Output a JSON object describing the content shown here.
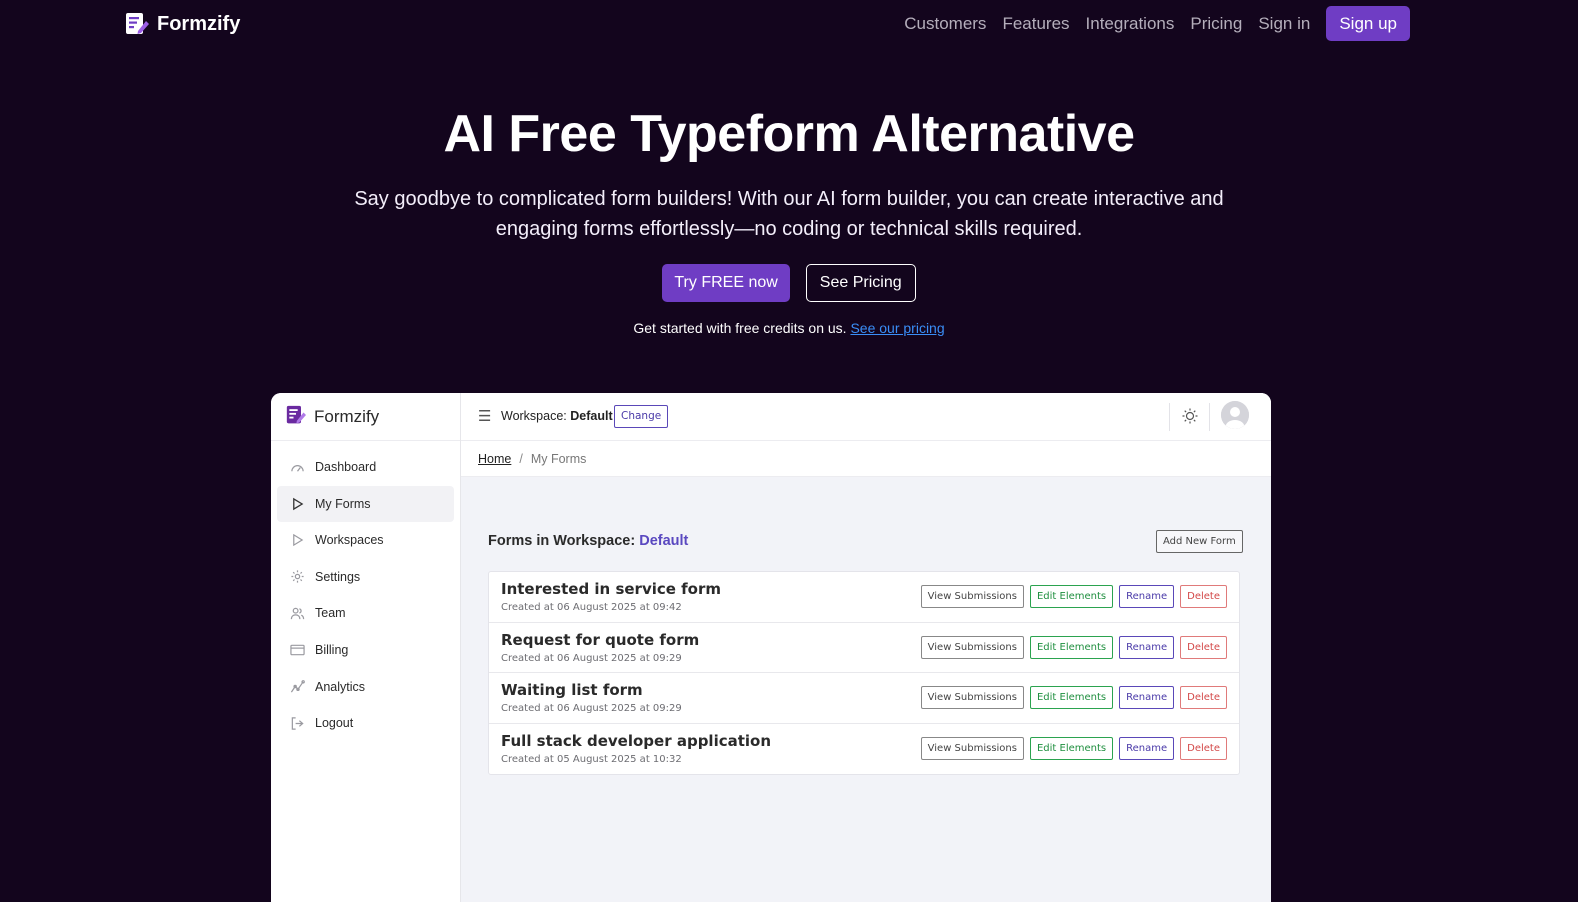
{
  "nav": {
    "brand": "Formzify",
    "links": [
      "Customers",
      "Features",
      "Integrations",
      "Pricing",
      "Sign in"
    ],
    "signup": "Sign up"
  },
  "hero": {
    "title": "AI Free Typeform Alternative",
    "subtitle": "Say goodbye to complicated form builders! With our AI form builder, you can create interactive and engaging forms effortlessly—no coding or technical skills required.",
    "cta_primary": "Try FREE now",
    "cta_secondary": "See Pricing",
    "note_text": "Get started with free credits on us.",
    "note_link": "See our pricing"
  },
  "app": {
    "brand": "Formzify",
    "sidebar": [
      {
        "label": "Dashboard",
        "icon": "gauge-icon"
      },
      {
        "label": "My Forms",
        "icon": "play-icon",
        "active": true
      },
      {
        "label": "Workspaces",
        "icon": "play-icon"
      },
      {
        "label": "Settings",
        "icon": "gear-icon"
      },
      {
        "label": "Team",
        "icon": "users-icon"
      },
      {
        "label": "Billing",
        "icon": "card-icon"
      },
      {
        "label": "Analytics",
        "icon": "chart-icon"
      },
      {
        "label": "Logout",
        "icon": "logout-icon"
      }
    ],
    "topbar": {
      "workspace_prefix": "Workspace:",
      "workspace_name": "Default",
      "change": "Change"
    },
    "breadcrumb": {
      "home": "Home",
      "sep": "/",
      "current": "My Forms"
    },
    "forms_heading_prefix": "Forms in Workspace:",
    "forms_heading_ws": "Default",
    "add_new": "Add New Form",
    "actions": {
      "view": "View Submissions",
      "edit": "Edit Elements",
      "rename": "Rename",
      "delete": "Delete"
    },
    "forms": [
      {
        "title": "Interested in service form",
        "created": "Created at 06 August 2025 at 09:42"
      },
      {
        "title": "Request for quote form",
        "created": "Created at 06 August 2025 at 09:29"
      },
      {
        "title": "Waiting list form",
        "created": "Created at 06 August 2025 at 09:29"
      },
      {
        "title": "Full stack developer application",
        "created": "Created at 05 August 2025 at 10:32"
      }
    ]
  },
  "colors": {
    "background": "#13051d",
    "accent": "#6f3dc4",
    "link": "#3a8ef7"
  }
}
